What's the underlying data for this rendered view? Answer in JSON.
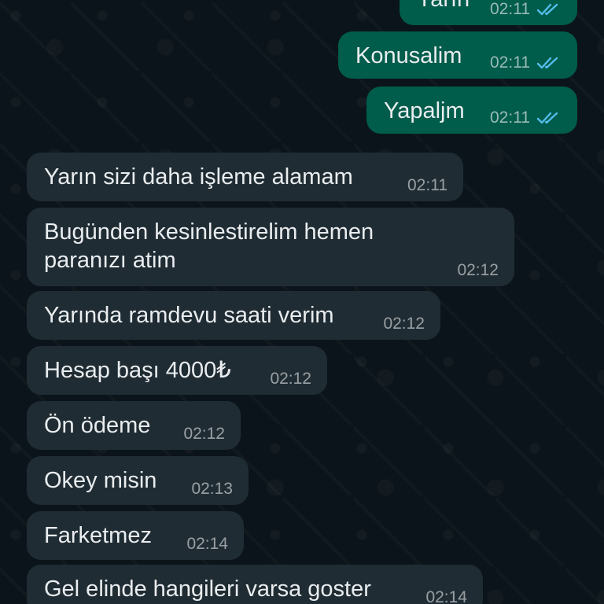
{
  "chat": {
    "messages": [
      {
        "direction": "out",
        "text": "Yarın",
        "time": "02:11",
        "read_receipt": "double-check-read-icon"
      },
      {
        "direction": "out",
        "text": "Konusalim",
        "time": "02:11",
        "read_receipt": "double-check-read-icon"
      },
      {
        "direction": "out",
        "text": "Yapaljm",
        "time": "02:11",
        "read_receipt": "double-check-read-icon"
      },
      {
        "direction": "in",
        "text": "Yarın sizi daha işleme alamam",
        "time": "02:11"
      },
      {
        "direction": "in",
        "text": "Bugünden kesinlestirelim hemen\nparanızı atim",
        "time": "02:12"
      },
      {
        "direction": "in",
        "text": "Yarında ramdevu saati verim",
        "time": "02:12"
      },
      {
        "direction": "in",
        "text": "Hesap başı 4000₺",
        "time": "02:12"
      },
      {
        "direction": "in",
        "text": "Ön ödeme",
        "time": "02:12"
      },
      {
        "direction": "in",
        "text": "Okey misin",
        "time": "02:13"
      },
      {
        "direction": "in",
        "text": "Farketmez",
        "time": "02:14"
      },
      {
        "direction": "in",
        "text": "Gel elinde hangileri varsa goster",
        "time": "02:14"
      }
    ]
  },
  "colors": {
    "background": "#0b141a",
    "incoming_bubble": "#202c33",
    "outgoing_bubble": "#005c4b",
    "read_check": "#53bdeb",
    "text": "#e9edef"
  }
}
